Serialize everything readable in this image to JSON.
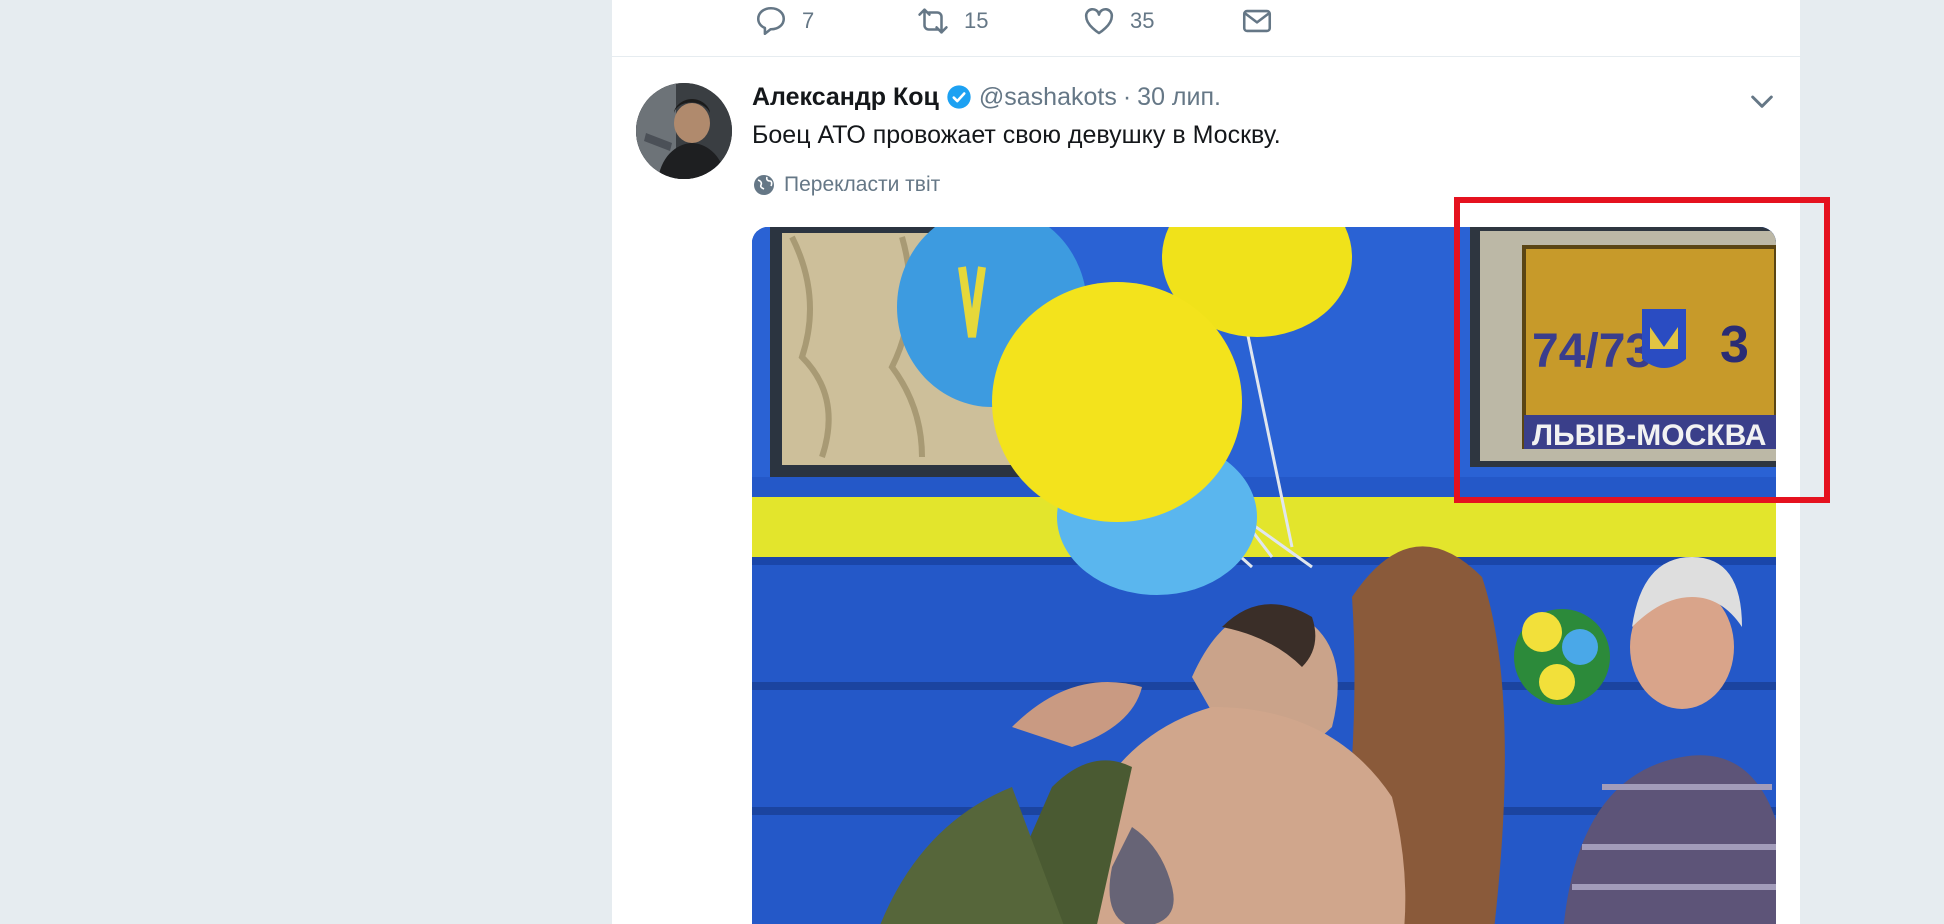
{
  "previous_tweet": {
    "reply_count": "7",
    "retweet_count": "15",
    "like_count": "35"
  },
  "tweet": {
    "author_name": "Александр Коц",
    "handle": "@sashakots",
    "separator": "·",
    "date": "30 лип.",
    "text": "Боец АТО провожает свою девушку в Москву.",
    "translate_label": "Перекласти твіт",
    "media": {
      "sign_number": "74/73",
      "sign_car": "3",
      "sign_route": "ЛЬВІВ-МОСКВА"
    }
  },
  "colors": {
    "highlight": "#e5121f",
    "verified": "#1da1f2",
    "secondary_text": "#657786"
  },
  "icons": [
    "reply-icon",
    "retweet-icon",
    "like-icon",
    "direct-message-icon",
    "verified-badge-icon",
    "chevron-down-icon",
    "globe-icon"
  ]
}
